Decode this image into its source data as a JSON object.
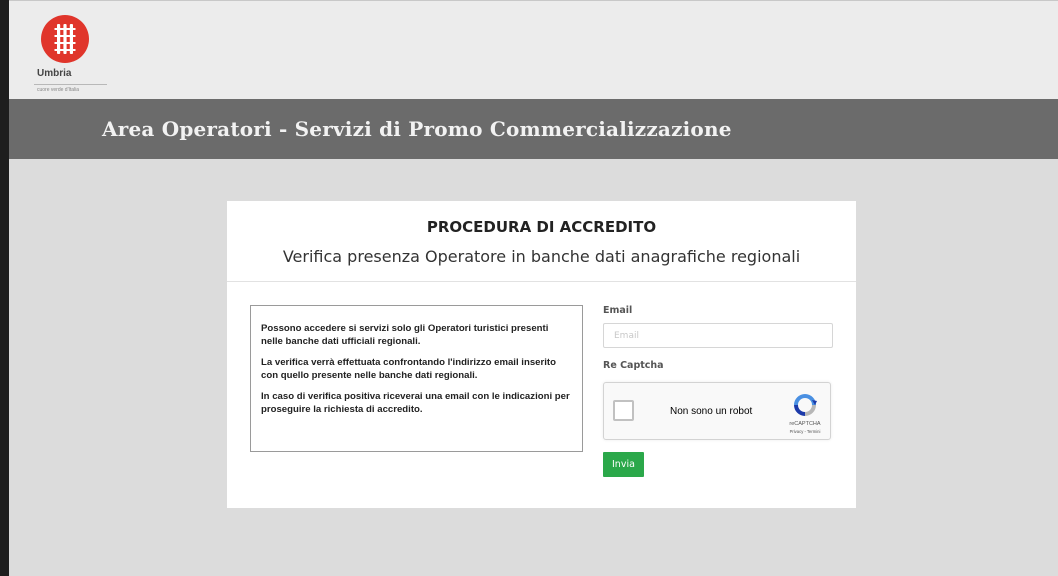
{
  "brand": {
    "logo_name": "Umbria",
    "logo_tagline": "cuore verde d'Italia",
    "logo_color": "#e0352b"
  },
  "header": {
    "title": "Area Operatori - Servizi di Promo Commercializzazione"
  },
  "card": {
    "title": "PROCEDURA DI ACCREDITO",
    "subtitle": "Verifica presenza Operatore in banche dati anagrafiche regionali"
  },
  "info": {
    "paragraphs": [
      "Possono accedere si servizi solo gli Operatori turistici presenti nelle banche dati ufficiali regionali.",
      "La verifica verrà effettuata confrontando l'indirizzo email inserito con quello presente nelle banche dati regionali.",
      "In caso di verifica positiva riceverai una email con le indicazioni per proseguire la richiesta di accredito."
    ]
  },
  "form": {
    "email_label": "Email",
    "email_placeholder": "Email",
    "email_value": "",
    "captcha_label": "Re Captcha",
    "recaptcha_checkbox_label": "Non sono un robot",
    "recaptcha_brand": "reCAPTCHA",
    "recaptcha_terms": "Privacy - Termini",
    "submit_label": "Invia",
    "submit_color": "#2ba84a"
  },
  "colors": {
    "title_band": "#6b6b6b",
    "page_background": "#dcdcdc"
  },
  "icons": {
    "logo": "umbria-logo-icon",
    "recaptcha": "recaptcha-icon"
  }
}
